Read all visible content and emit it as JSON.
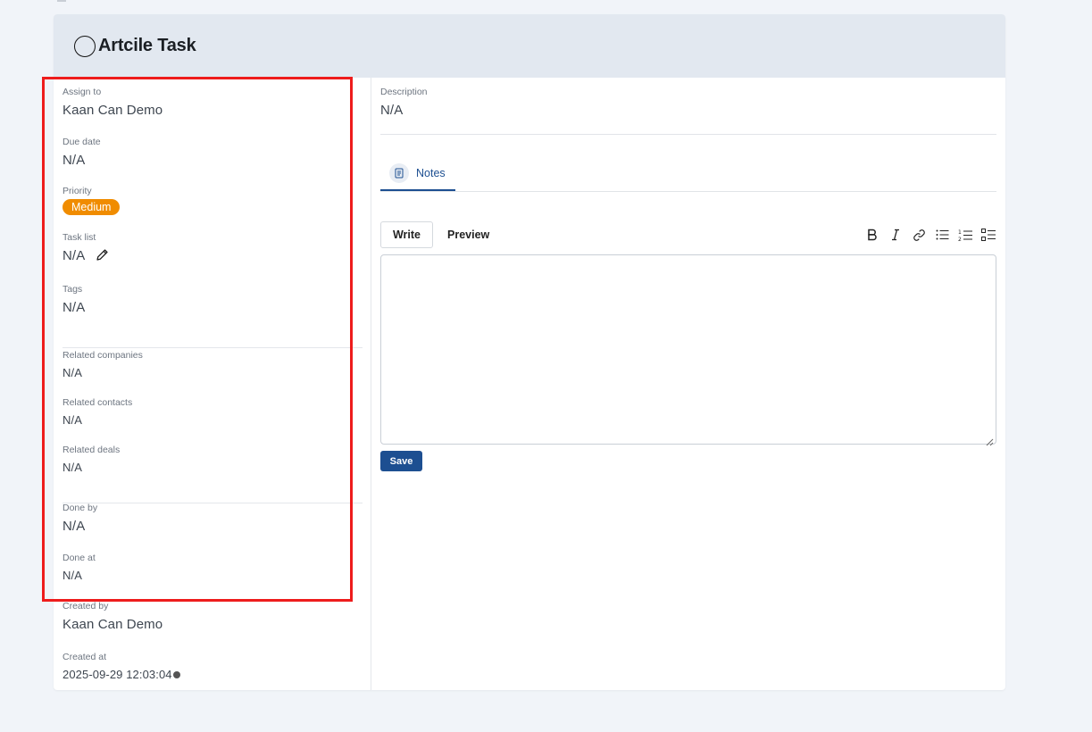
{
  "task": {
    "title": "Artcile Task"
  },
  "fields": {
    "assign_to": {
      "label": "Assign to",
      "value": "Kaan Can Demo"
    },
    "due_date": {
      "label": "Due date",
      "value": "N/A"
    },
    "priority": {
      "label": "Priority",
      "value": "Medium",
      "color": "#f08c00"
    },
    "task_list": {
      "label": "Task list",
      "value": "N/A"
    },
    "tags": {
      "label": "Tags",
      "value": "N/A"
    },
    "related_companies": {
      "label": "Related companies",
      "value": "N/A"
    },
    "related_contacts": {
      "label": "Related contacts",
      "value": "N/A"
    },
    "related_deals": {
      "label": "Related deals",
      "value": "N/A"
    },
    "done_by": {
      "label": "Done by",
      "value": "N/A"
    },
    "done_at": {
      "label": "Done at",
      "value": "N/A"
    },
    "created_by": {
      "label": "Created by",
      "value": "Kaan Can Demo"
    },
    "created_at": {
      "label": "Created at",
      "value": "2025-09-29 12:03:04"
    }
  },
  "description": {
    "label": "Description",
    "value": "N/A"
  },
  "tabs": [
    {
      "label": "Notes",
      "icon": "note-icon",
      "active": true
    }
  ],
  "editor": {
    "write_label": "Write",
    "preview_label": "Preview",
    "toolbar": [
      "bold-icon",
      "italic-icon",
      "link-icon",
      "bullet-list-icon",
      "numbered-list-icon",
      "task-list-icon"
    ],
    "value": "",
    "save_label": "Save"
  },
  "colors": {
    "accent": "#1d4f91",
    "highlight": "#ee1c1c"
  }
}
